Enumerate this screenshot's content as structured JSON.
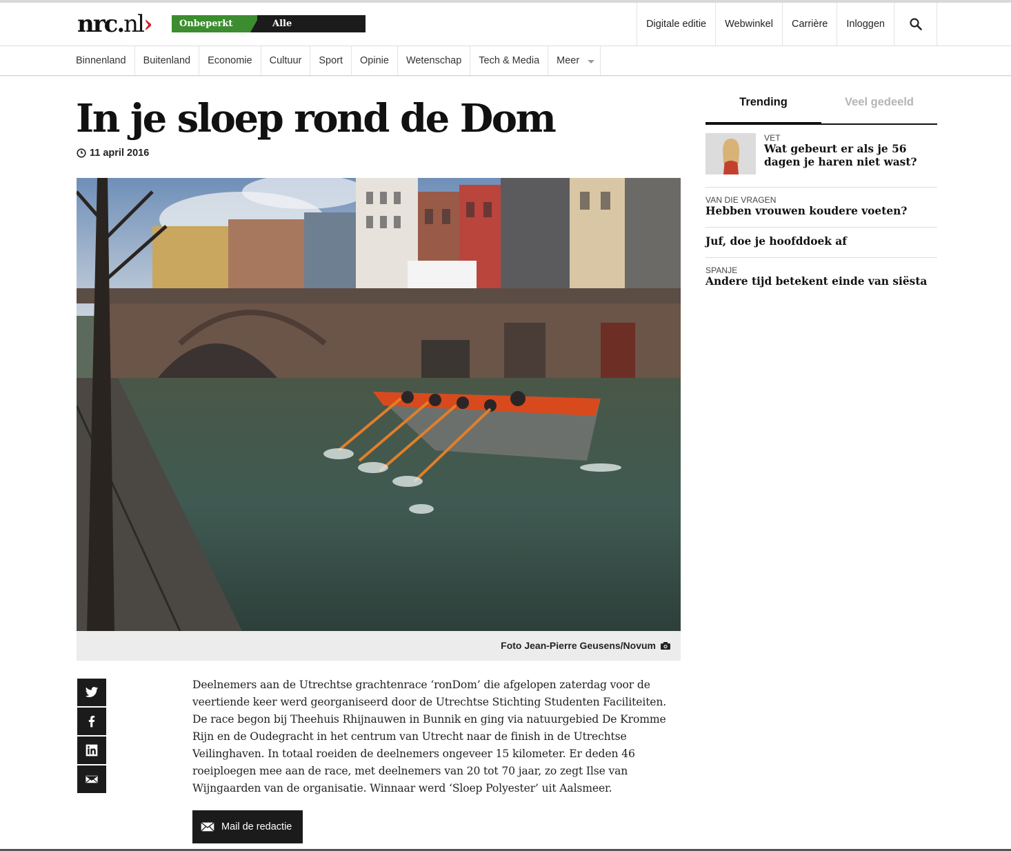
{
  "header": {
    "logo_main": "nrc.",
    "logo_nl": "nl",
    "logo_chevron": "›",
    "promo_green": "Onbeperkt nrc.nl",
    "promo_black": "Alle abonnementen",
    "links": [
      "Digitale editie",
      "Webwinkel",
      "Carrière",
      "Inloggen"
    ],
    "search_icon": "search-icon"
  },
  "sections": [
    "Binnenland",
    "Buitenland",
    "Economie",
    "Cultuur",
    "Sport",
    "Opinie",
    "Wetenschap",
    "Tech & Media",
    "Meer"
  ],
  "article": {
    "title": "In je sloep rond de Dom",
    "date": "11 april 2016",
    "photo_caption": "Foto Jean-Pierre Geusens/Novum",
    "body": "Deelnemers aan de Utrechtse grachtenrace ‘ronDom’ die afgelopen zaterdag voor de veertiende keer werd georganiseerd door de Utrechtse Stichting Studenten Faciliteiten. De race begon bij Theehuis Rhijnauwen in Bunnik en ging via natuurgebied De Kromme Rijn en de Oudegracht in het centrum van Utrecht naar de finish in de Utrechtse Veilinghaven. In totaal roeiden de deelnemers ongeveer 15 kilometer. Er deden 46 roeiploegen mee aan de race, met deelnemers van 20 tot 70 jaar, zo zegt Ilse van Wijngaarden van de organisatie. Winnaar werd ‘Sloep Polyester’ uit Aalsmeer.",
    "mail_button": "Mail de redactie"
  },
  "share": [
    "twitter-icon",
    "facebook-icon",
    "linkedin-icon",
    "mail-icon"
  ],
  "sidebar": {
    "tabs": [
      "Trending",
      "Veel gedeeld"
    ],
    "items": [
      {
        "kicker": "VET",
        "headline": "Wat gebeurt er als je 56 dagen je haren niet wast?"
      },
      {
        "kicker": "VAN DIE VRAGEN",
        "headline": "Hebben vrouwen koudere voeten?"
      },
      {
        "kicker": "",
        "headline": "Juf, doe je hoofddoek af"
      },
      {
        "kicker": "SPANJE",
        "headline": "Andere tijd betekent einde van siësta"
      }
    ]
  },
  "colors": {
    "accent_red": "#d61f26",
    "promo_green": "#3c8d2f",
    "dark": "#1b1b1b"
  }
}
